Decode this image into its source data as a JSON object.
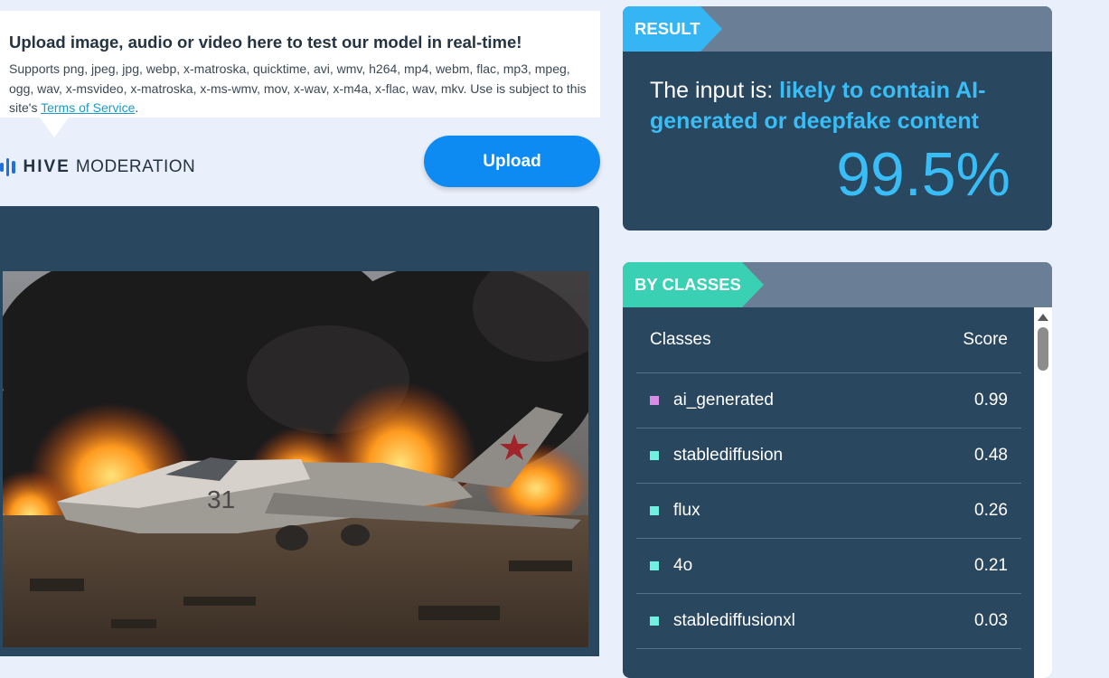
{
  "upload_panel": {
    "title": "Upload image, audio or video here to test our model in real-time!",
    "description": "Supports png, jpeg, jpg, webp, x-matroska, quicktime, avi, wmv, h264, mp4, webm, flac, mp3, mpeg, ogg, wav, x-msvideo, x-matroska, x-ms-wmv, mov, x-wav, x-m4a, x-flac, wav, mkv. Use is subject to this site's",
    "terms_link": "Terms of Service",
    "terms_suffix": ".",
    "brand_hive": "HIVE",
    "brand_moderation": "MODERATION",
    "upload_button": "Upload",
    "brand_color": "#1e6fe0",
    "button_color": "#0d8bf2"
  },
  "preview": {
    "image_icon": "photo-preview"
  },
  "result": {
    "tag": "RESULT",
    "prefix": "The input is: ",
    "verdict": "likely to contain AI-generated or deepfake content",
    "percentage": "99.5%",
    "accent_color": "#39bdf6"
  },
  "by_classes": {
    "tag": "BY CLASSES",
    "headers": {
      "classes": "Classes",
      "score": "Score"
    },
    "rows": [
      {
        "name": "ai_generated",
        "score": "0.99",
        "color": "#d98ce6"
      },
      {
        "name": "stablediffusion",
        "score": "0.48",
        "color": "#6ff0e0"
      },
      {
        "name": "flux",
        "score": "0.26",
        "color": "#6ff0e0"
      },
      {
        "name": "4o",
        "score": "0.21",
        "color": "#6ff0e0"
      },
      {
        "name": "stablediffusionxl",
        "score": "0.03",
        "color": "#6ff0e0"
      }
    ],
    "accent_color": "#3ad0b3"
  }
}
